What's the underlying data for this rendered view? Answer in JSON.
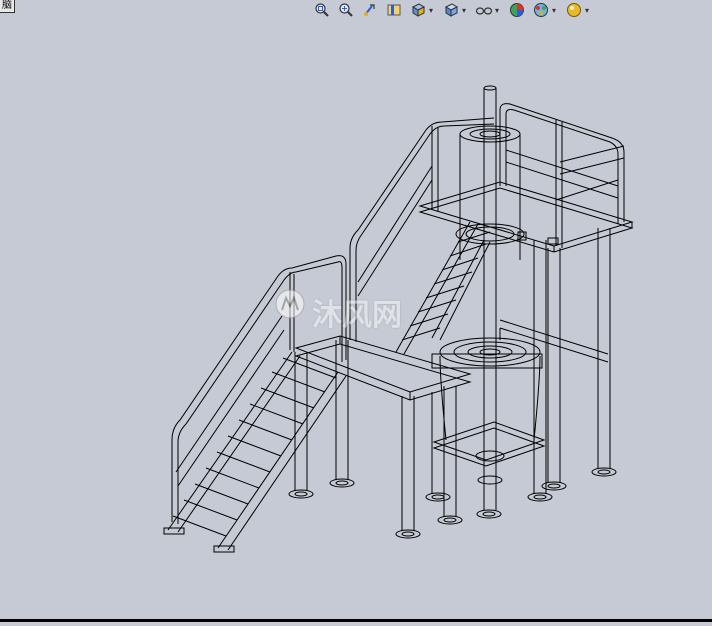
{
  "corner_label": "脑",
  "watermark_text": "沐风网",
  "toolbar": {
    "buttons": [
      {
        "name": "zoom-to-fit-icon",
        "has_menu": false
      },
      {
        "name": "zoom-to-area-icon",
        "has_menu": false
      },
      {
        "name": "previous-view-icon",
        "has_menu": false
      },
      {
        "name": "section-view-icon",
        "has_menu": false
      },
      {
        "name": "view-orientation-icon",
        "has_menu": true
      },
      {
        "name": "display-style-icon",
        "has_menu": true
      },
      {
        "name": "hide-show-items-icon",
        "has_menu": true
      },
      {
        "name": "edit-appearance-icon",
        "has_menu": false
      },
      {
        "name": "apply-scene-icon",
        "has_menu": true
      },
      {
        "name": "view-settings-icon",
        "has_menu": true
      }
    ]
  },
  "colors": {
    "background": "#c6cad5",
    "wireframe": "#000000",
    "accent_blue": "#2b5fd6",
    "accent_yellow": "#e0b020"
  }
}
